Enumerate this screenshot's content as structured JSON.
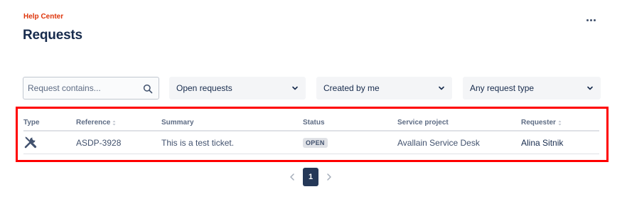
{
  "header": {
    "breadcrumb": "Help Center",
    "title": "Requests",
    "more_icon": "more-horizontal-icon"
  },
  "filters": {
    "search": {
      "placeholder": "Request contains...",
      "value": "",
      "icon": "search-icon"
    },
    "status_select": "Open requests",
    "creator_select": "Created by me",
    "type_select": "Any request type",
    "chevron_icon": "chevron-down-icon"
  },
  "table": {
    "columns": [
      "Type",
      "Reference",
      "Summary",
      "Status",
      "Service project",
      "Requester"
    ],
    "sortable_columns": [
      "Reference",
      "Requester"
    ],
    "rows": [
      {
        "type_icon": "tools-icon",
        "reference": "ASDP-3928",
        "summary": "This is a test ticket.",
        "status": "OPEN",
        "service_project": "Avallain Service Desk",
        "requester": "Alina Sitnik"
      }
    ]
  },
  "pagination": {
    "current_page": "1",
    "prev_icon": "chevron-left-icon",
    "next_icon": "chevron-right-icon"
  },
  "colors": {
    "breadcrumb": "#de350b",
    "title": "#172b4d",
    "highlight_frame": "#ff0000",
    "status_lozenge_bg": "#dfe1e6",
    "pager_current_bg": "#253858"
  }
}
